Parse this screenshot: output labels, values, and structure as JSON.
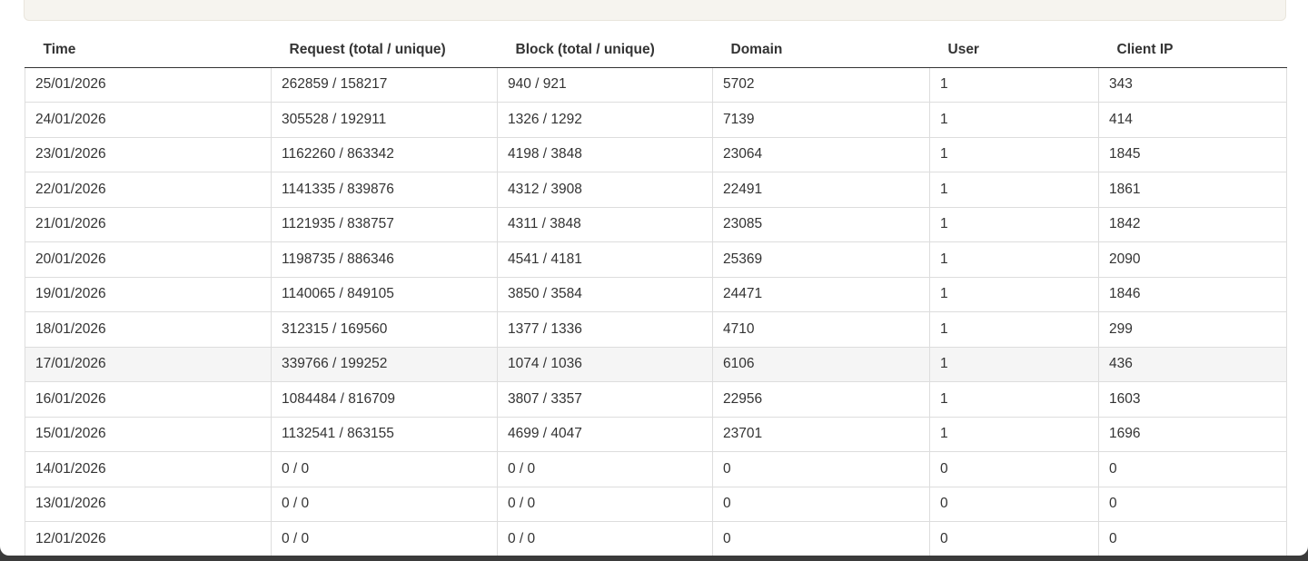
{
  "table": {
    "headers": [
      "Time",
      "Request (total / unique)",
      "Block (total / unique)",
      "Domain",
      "User",
      "Client IP"
    ],
    "rows": [
      {
        "time": "25/01/2026",
        "request": "262859 / 158217",
        "block": "940 / 921",
        "domain": "5702",
        "user": "1",
        "client_ip": "343"
      },
      {
        "time": "24/01/2026",
        "request": "305528 / 192911",
        "block": "1326 / 1292",
        "domain": "7139",
        "user": "1",
        "client_ip": "414"
      },
      {
        "time": "23/01/2026",
        "request": "1162260 / 863342",
        "block": "4198 / 3848",
        "domain": "23064",
        "user": "1",
        "client_ip": "1845"
      },
      {
        "time": "22/01/2026",
        "request": "1141335 / 839876",
        "block": "4312 / 3908",
        "domain": "22491",
        "user": "1",
        "client_ip": "1861"
      },
      {
        "time": "21/01/2026",
        "request": "1121935 / 838757",
        "block": "4311 / 3848",
        "domain": "23085",
        "user": "1",
        "client_ip": "1842"
      },
      {
        "time": "20/01/2026",
        "request": "1198735 / 886346",
        "block": "4541 / 4181",
        "domain": "25369",
        "user": "1",
        "client_ip": "2090"
      },
      {
        "time": "19/01/2026",
        "request": "1140065 / 849105",
        "block": "3850 / 3584",
        "domain": "24471",
        "user": "1",
        "client_ip": "1846"
      },
      {
        "time": "18/01/2026",
        "request": "312315 / 169560",
        "block": "1377 / 1336",
        "domain": "4710",
        "user": "1",
        "client_ip": "299"
      },
      {
        "time": "17/01/2026",
        "request": "339766 / 199252",
        "block": "1074 / 1036",
        "domain": "6106",
        "user": "1",
        "client_ip": "436"
      },
      {
        "time": "16/01/2026",
        "request": "1084484 / 816709",
        "block": "3807 / 3357",
        "domain": "22956",
        "user": "1",
        "client_ip": "1603"
      },
      {
        "time": "15/01/2026",
        "request": "1132541 / 863155",
        "block": "4699 / 4047",
        "domain": "23701",
        "user": "1",
        "client_ip": "1696"
      },
      {
        "time": "14/01/2026",
        "request": "0 / 0",
        "block": "0 / 0",
        "domain": "0",
        "user": "0",
        "client_ip": "0"
      },
      {
        "time": "13/01/2026",
        "request": "0 / 0",
        "block": "0 / 0",
        "domain": "0",
        "user": "0",
        "client_ip": "0"
      },
      {
        "time": "12/01/2026",
        "request": "0 / 0",
        "block": "0 / 0",
        "domain": "0",
        "user": "0",
        "client_ip": "0"
      }
    ],
    "hovered_row_index": 8
  },
  "colors": {
    "panel_background": "#f6f4ef",
    "row_hover": "#f5f5f5",
    "cell_border": "#dddddd",
    "header_border": "#333333",
    "text": "#333333",
    "window_frame": "#3b3b3b"
  }
}
